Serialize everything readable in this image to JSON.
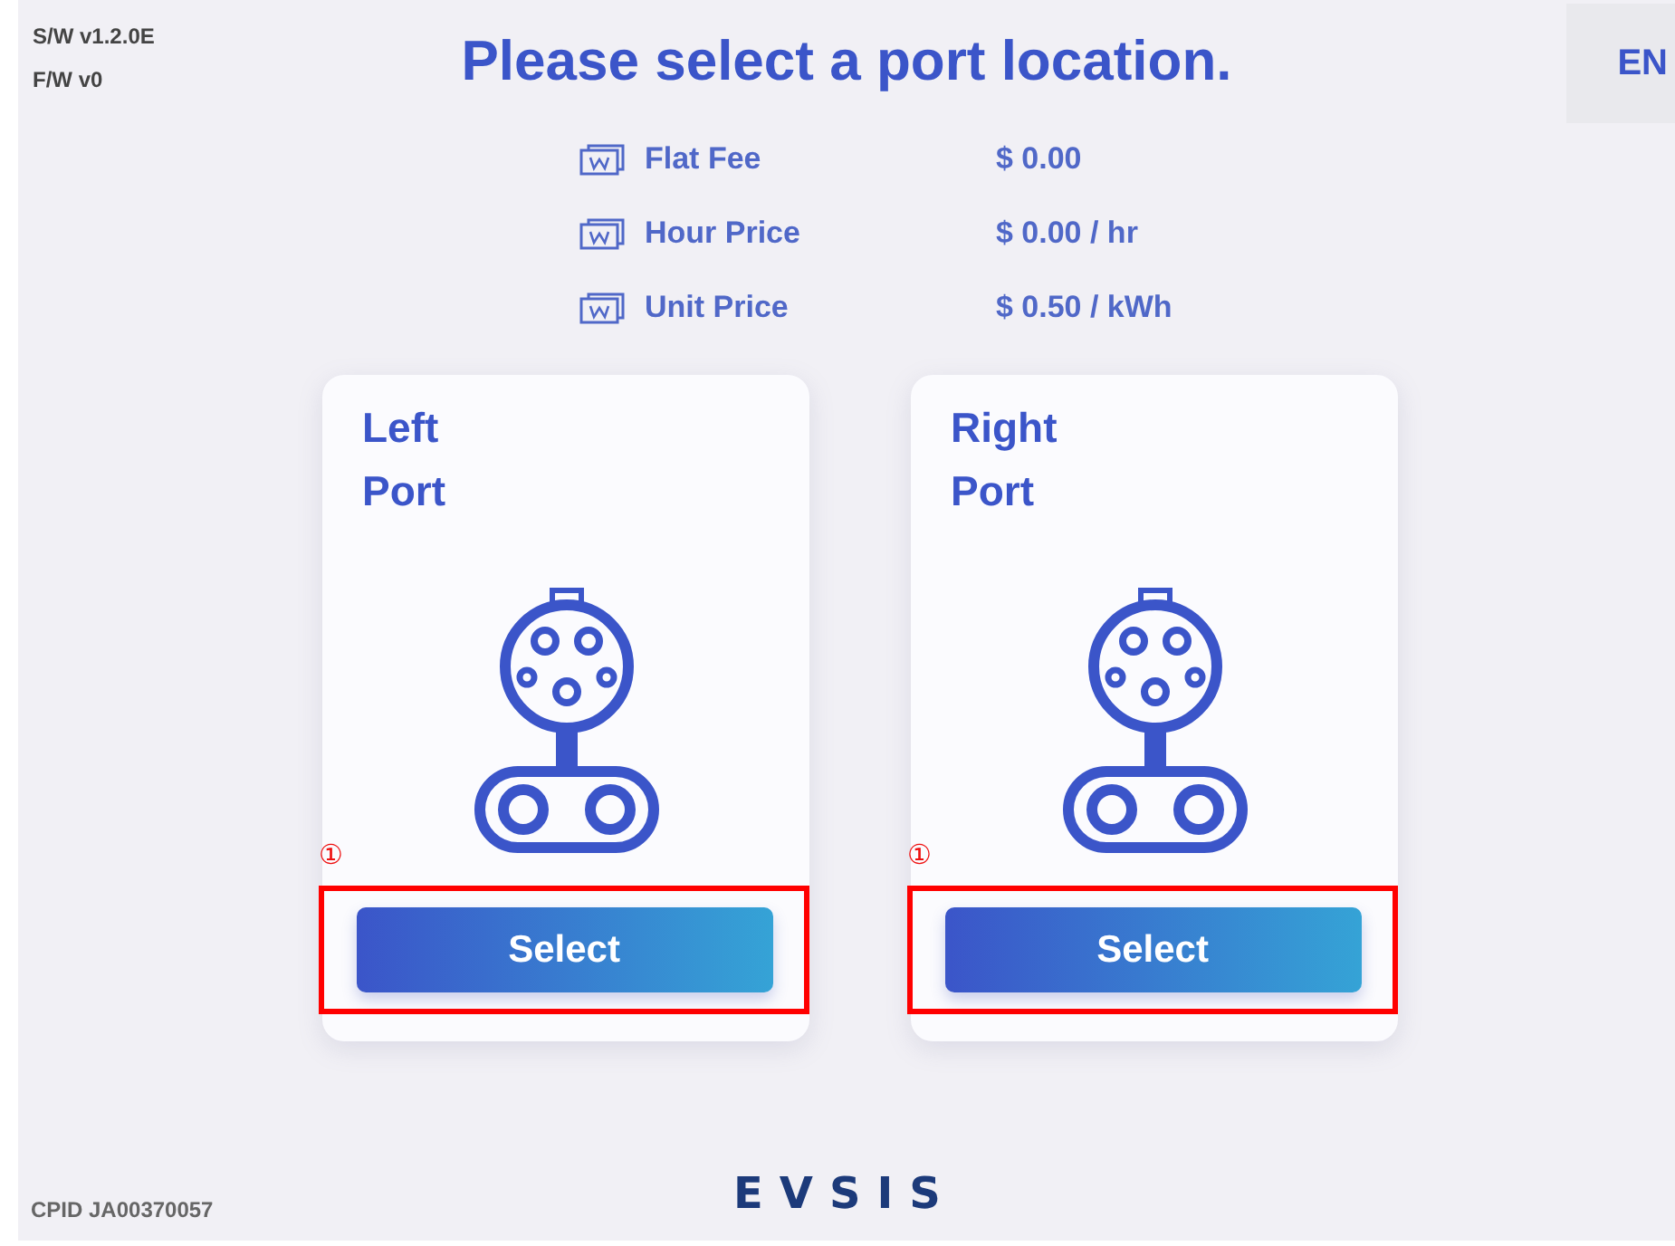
{
  "versions": [
    "S/W v1.2.0E",
    "F/W v0"
  ],
  "title": "Please select a port location.",
  "language_button": "EN",
  "prices": [
    {
      "label": "Flat Fee",
      "value": "$ 0.00"
    },
    {
      "label": "Hour Price",
      "value": "$ 0.00 / hr"
    },
    {
      "label": "Unit Price",
      "value": "$ 0.50 / kWh"
    }
  ],
  "ports": [
    {
      "title_lines": [
        "Left",
        "Port"
      ],
      "button": "Select",
      "annotation": "①"
    },
    {
      "title_lines": [
        "Right",
        "Port"
      ],
      "button": "Select",
      "annotation": "①"
    }
  ],
  "cpid": "CPID JA00370057",
  "logo": "EVSIS"
}
